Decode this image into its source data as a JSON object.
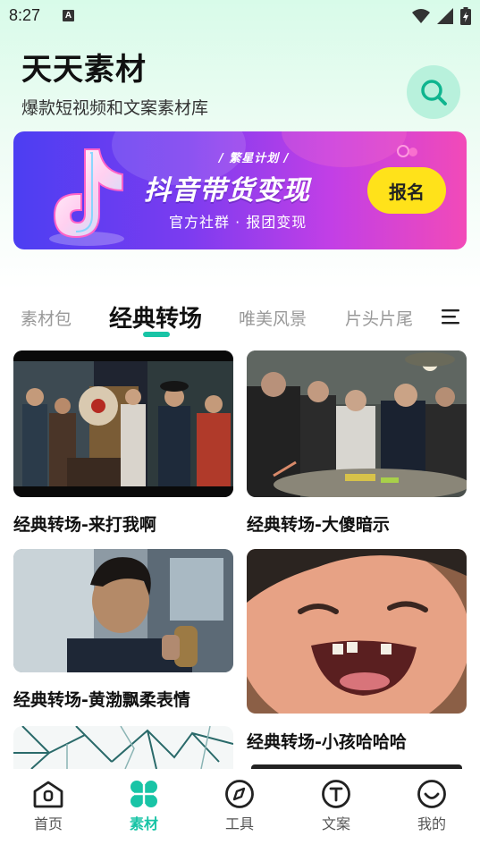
{
  "status": {
    "time": "8:27",
    "indicator": "A"
  },
  "header": {
    "title": "天天素材",
    "subtitle": "爆款短视频和文案素材库"
  },
  "banner": {
    "tag": "/ 繁星计划 /",
    "headline": "抖音带货变现",
    "subline": "官方社群 · 报团变现",
    "button": "报名"
  },
  "tabs": [
    {
      "label": "素材包"
    },
    {
      "label": "经典转场"
    },
    {
      "label": "唯美风景"
    },
    {
      "label": "片头片尾"
    }
  ],
  "active_tab": "经典转场",
  "cards": [
    {
      "title": "经典转场-来打我啊"
    },
    {
      "title": "经典转场-大傻暗示"
    },
    {
      "title": "经典转场-黄渤飘柔表情"
    },
    {
      "title": "经典转场-小孩哈哈哈"
    }
  ],
  "nav": [
    {
      "label": "首页",
      "icon": "home-icon"
    },
    {
      "label": "素材",
      "icon": "clover-icon"
    },
    {
      "label": "工具",
      "icon": "compass-icon"
    },
    {
      "label": "文案",
      "icon": "text-icon"
    },
    {
      "label": "我的",
      "icon": "smile-icon"
    }
  ],
  "colors": {
    "accent": "#19c4a6",
    "banner_button": "#ffe21a"
  }
}
